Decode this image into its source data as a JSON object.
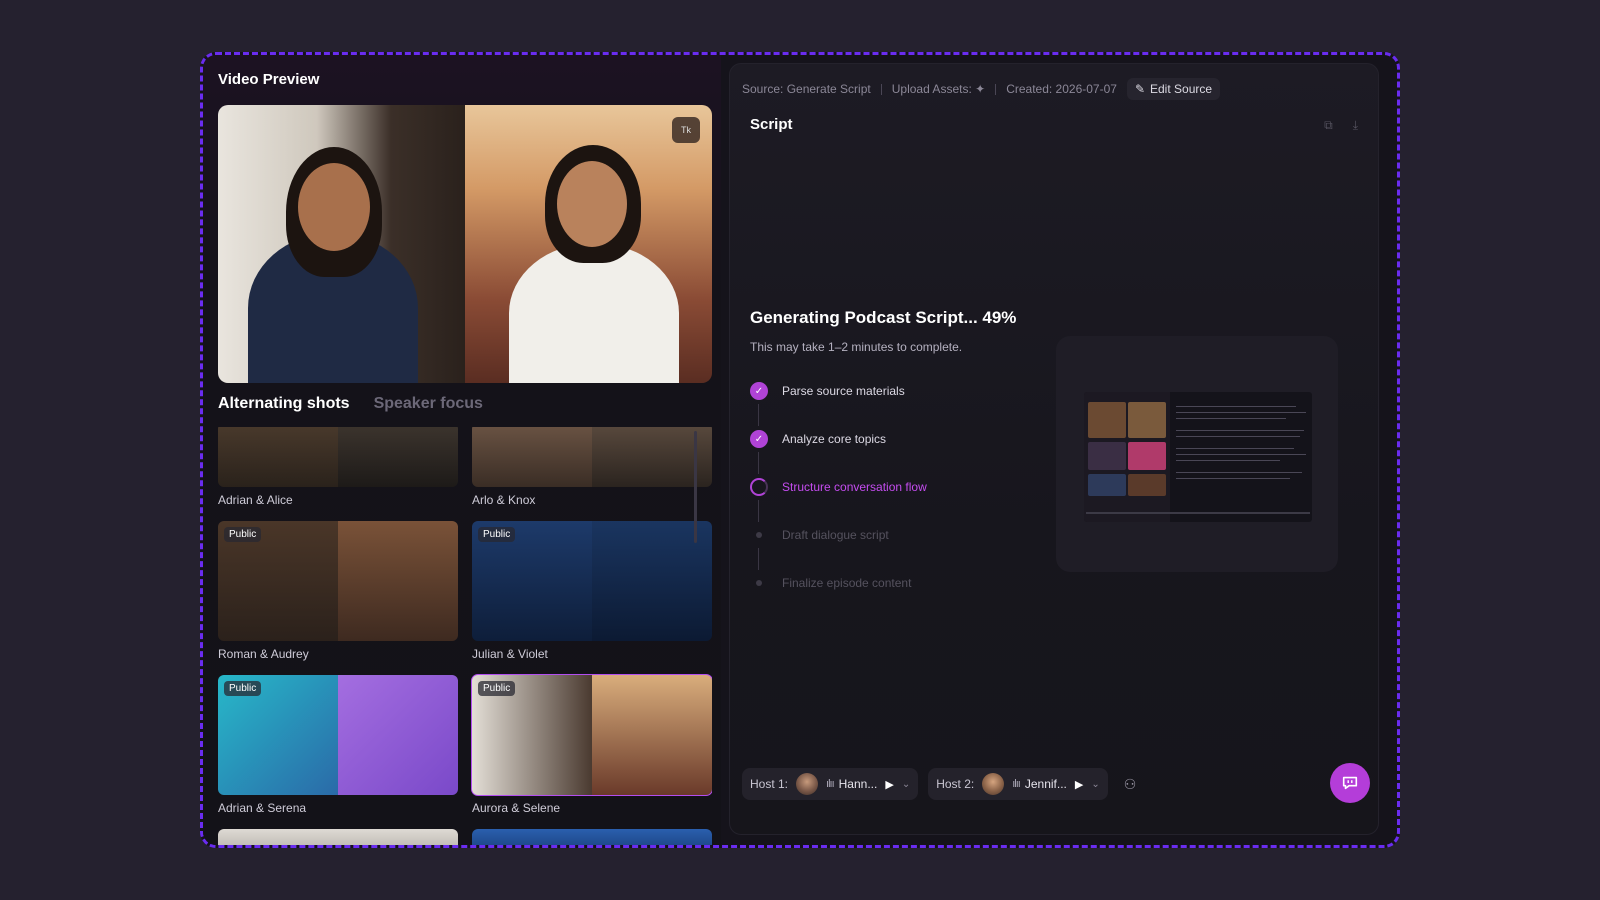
{
  "left_panel": {
    "title": "Video Preview",
    "preview_badge": "Tk",
    "tabs": [
      {
        "label": "Alternating shots",
        "active": true
      },
      {
        "label": "Speaker focus",
        "active": false
      }
    ],
    "cards": [
      {
        "name": "Adrian & Alice",
        "public": false,
        "badge": ""
      },
      {
        "name": "Arlo & Knox",
        "public": false,
        "badge": ""
      },
      {
        "name": "Roman & Audrey",
        "public": true,
        "badge": "Public"
      },
      {
        "name": "Julian & Violet",
        "public": true,
        "badge": "Public"
      },
      {
        "name": "Adrian & Serena",
        "public": true,
        "badge": "Public"
      },
      {
        "name": "Aurora & Selene",
        "public": true,
        "badge": "Public",
        "selected": true
      }
    ]
  },
  "right_panel": {
    "source": "Source: Generate Script",
    "upload": "Upload Assets:",
    "created": "Created: 2026-07-07",
    "edit_source": "Edit Source",
    "script_title": "Script",
    "generating": "Generating Podcast Script... 49%",
    "progress": 49,
    "subtitle": "This may take 1–2 minutes to complete.",
    "steps": [
      {
        "label": "Parse source materials",
        "status": "done"
      },
      {
        "label": "Analyze core topics",
        "status": "done"
      },
      {
        "label": "Structure conversation flow",
        "status": "active"
      },
      {
        "label": "Draft dialogue script",
        "status": "pending"
      },
      {
        "label": "Finalize episode content",
        "status": "pending"
      }
    ],
    "hosts": [
      {
        "label": "Host 1:",
        "name": "Hann..."
      },
      {
        "label": "Host 2:",
        "name": "Jennif..."
      }
    ]
  },
  "colors": {
    "accent": "#b043d6",
    "frame_border": "#6a2cf0",
    "background": "#25212f"
  }
}
